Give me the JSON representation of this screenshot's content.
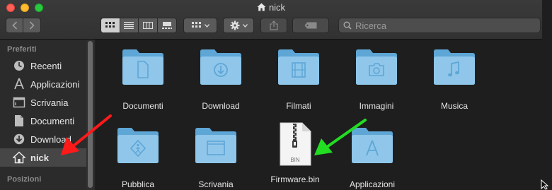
{
  "window": {
    "title": "nick"
  },
  "toolbar": {
    "back_icon": "chevron-left-icon",
    "forward_icon": "chevron-right-icon",
    "view_modes": [
      "icon-view",
      "list-view",
      "column-view",
      "gallery-view"
    ],
    "active_view": "icon-view",
    "group_icon": "grid-icon",
    "action_icon": "gear-icon",
    "share_icon": "share-icon",
    "tag_icon": "tag-icon"
  },
  "search": {
    "placeholder": "Ricerca"
  },
  "sidebar": {
    "section_favorites": "Preferiti",
    "section_locations": "Posizioni",
    "items": [
      {
        "label": "Recenti",
        "icon": "clock-icon"
      },
      {
        "label": "Applicazioni",
        "icon": "applications-icon"
      },
      {
        "label": "Scrivania",
        "icon": "desktop-icon"
      },
      {
        "label": "Documenti",
        "icon": "document-icon"
      },
      {
        "label": "Download",
        "icon": "download-icon"
      },
      {
        "label": "nick",
        "icon": "home-icon",
        "selected": true
      }
    ]
  },
  "files": [
    {
      "label": "Documenti",
      "icon": "folder-documents-icon"
    },
    {
      "label": "Download",
      "icon": "folder-download-icon"
    },
    {
      "label": "Filmati",
      "icon": "folder-movies-icon"
    },
    {
      "label": "Immagini",
      "icon": "folder-pictures-icon"
    },
    {
      "label": "Musica",
      "icon": "folder-music-icon"
    },
    {
      "label": "Pubblica",
      "icon": "folder-public-icon"
    },
    {
      "label": "Scrivania",
      "icon": "folder-desktop-icon"
    },
    {
      "label": "Firmware.bin",
      "icon": "zip-file-icon",
      "badge": "BIN"
    },
    {
      "label": "Applicazioni",
      "icon": "folder-applications-icon"
    }
  ],
  "colors": {
    "folder_light": "#8fc6ea",
    "folder_dark": "#5ea6d6",
    "annotation_red": "#ff1a1a",
    "annotation_green": "#22dd22"
  }
}
